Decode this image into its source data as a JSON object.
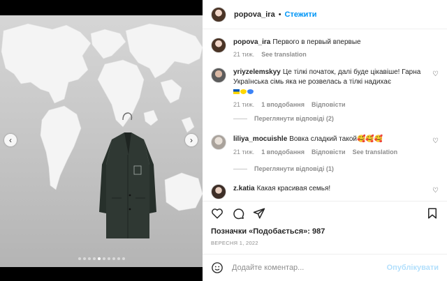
{
  "post": {
    "author": "popova_ira",
    "separator": "•",
    "follow_label": "Стежити"
  },
  "caption": {
    "username": "popova_ira",
    "text": "Первого в первый впервые",
    "time": "21 тиж.",
    "see_translation": "See translation"
  },
  "comments": [
    {
      "username": "yriyzelemskyy",
      "text": "Це тілкі початок, далі буде цікавіше! Гарна Українська сімь яка не розвелась а тілкі надихає",
      "time": "21 тиж.",
      "likes": "1 вподобання",
      "reply": "Відповісти",
      "view_replies": "Переглянути відповіді (2)",
      "flag_colors": [
        "#0057b7",
        "#ffd700",
        "#3b82f6"
      ]
    },
    {
      "username": "liliya_mocuishle",
      "text": "Вовка сладкий такой",
      "emoji": "🥰🥰🥰",
      "time": "21 тиж.",
      "likes": "1 вподобання",
      "reply": "Відповісти",
      "see_translation": "See translation",
      "view_replies": "Переглянути відповіді (1)"
    },
    {
      "username": "z.katia",
      "text": "Какая красивая семья!"
    }
  ],
  "actions": {
    "likes_text": "Позначки «Подобається»: 987",
    "date": "ВЕРЕСНЯ 1, 2022",
    "icons": [
      "heart-icon",
      "comment-icon",
      "share-icon",
      "bookmark-icon"
    ]
  },
  "add_comment": {
    "placeholder": "Додайте коментар...",
    "publish_label": "Опублікувати"
  },
  "carousel": {
    "prev": "‹",
    "next": "›",
    "dot_count": 10,
    "active_index": 4
  },
  "colors": {
    "accent": "#0095f6",
    "publish_disabled": "#b2dffc",
    "muted": "#8e8e8e"
  }
}
